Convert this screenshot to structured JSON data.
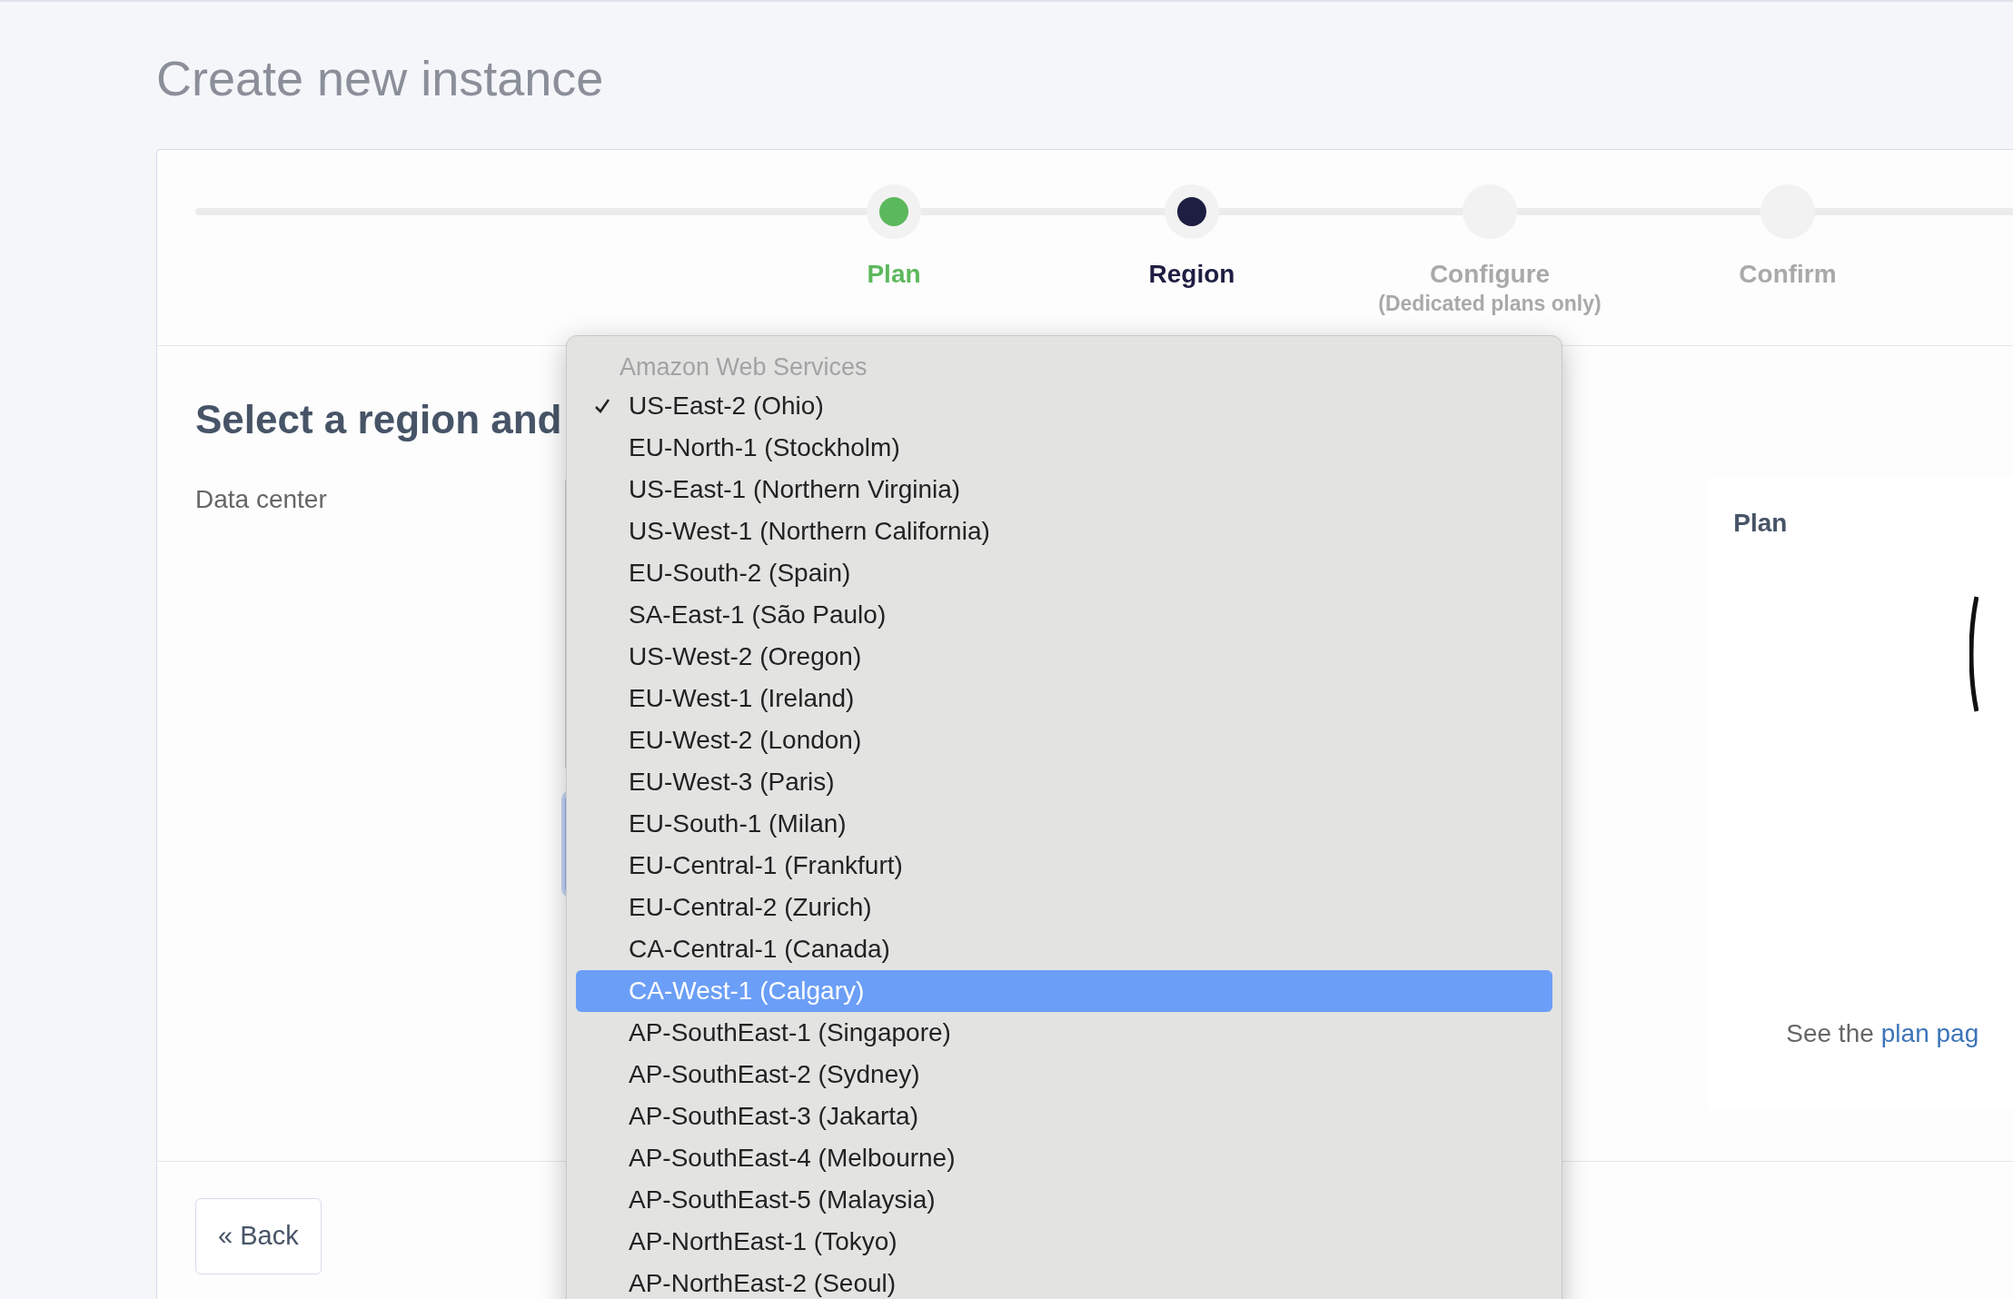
{
  "page": {
    "title": "Create new instance"
  },
  "steps": [
    {
      "label": "Plan",
      "done": true,
      "selected": false
    },
    {
      "label": "Region",
      "done": false,
      "selected": true
    },
    {
      "label": "Configure",
      "sublabel": "(Dedicated plans only)",
      "done": false,
      "selected": false
    },
    {
      "label": "Confirm",
      "done": false,
      "selected": false
    }
  ],
  "section": {
    "heading": "Select a region and",
    "field_label": "Data center"
  },
  "dropdown": {
    "group": "Amazon Web Services",
    "options": [
      {
        "label": "US-East-2 (Ohio)",
        "checked": true,
        "selected": false
      },
      {
        "label": "EU-North-1 (Stockholm)",
        "checked": false,
        "selected": false
      },
      {
        "label": "US-East-1 (Northern Virginia)",
        "checked": false,
        "selected": false
      },
      {
        "label": "US-West-1 (Northern California)",
        "checked": false,
        "selected": false
      },
      {
        "label": "EU-South-2 (Spain)",
        "checked": false,
        "selected": false
      },
      {
        "label": "SA-East-1 (São Paulo)",
        "checked": false,
        "selected": false
      },
      {
        "label": "US-West-2 (Oregon)",
        "checked": false,
        "selected": false
      },
      {
        "label": "EU-West-1 (Ireland)",
        "checked": false,
        "selected": false
      },
      {
        "label": "EU-West-2 (London)",
        "checked": false,
        "selected": false
      },
      {
        "label": "EU-West-3 (Paris)",
        "checked": false,
        "selected": false
      },
      {
        "label": "EU-South-1 (Milan)",
        "checked": false,
        "selected": false
      },
      {
        "label": "EU-Central-1 (Frankfurt)",
        "checked": false,
        "selected": false
      },
      {
        "label": "EU-Central-2 (Zurich)",
        "checked": false,
        "selected": false
      },
      {
        "label": "CA-Central-1 (Canada)",
        "checked": false,
        "selected": false
      },
      {
        "label": "CA-West-1 (Calgary)",
        "checked": false,
        "selected": true
      },
      {
        "label": "AP-SouthEast-1 (Singapore)",
        "checked": false,
        "selected": false
      },
      {
        "label": "AP-SouthEast-2 (Sydney)",
        "checked": false,
        "selected": false
      },
      {
        "label": "AP-SouthEast-3 (Jakarta)",
        "checked": false,
        "selected": false
      },
      {
        "label": "AP-SouthEast-4 (Melbourne)",
        "checked": false,
        "selected": false
      },
      {
        "label": "AP-SouthEast-5 (Malaysia)",
        "checked": false,
        "selected": false
      },
      {
        "label": "AP-NorthEast-1 (Tokyo)",
        "checked": false,
        "selected": false
      },
      {
        "label": "AP-NorthEast-2 (Seoul)",
        "checked": false,
        "selected": false
      }
    ]
  },
  "plan_panel": {
    "title": "Plan",
    "note": "See the",
    "link": "plan pag"
  },
  "footer": {
    "back_button": "« Back"
  }
}
